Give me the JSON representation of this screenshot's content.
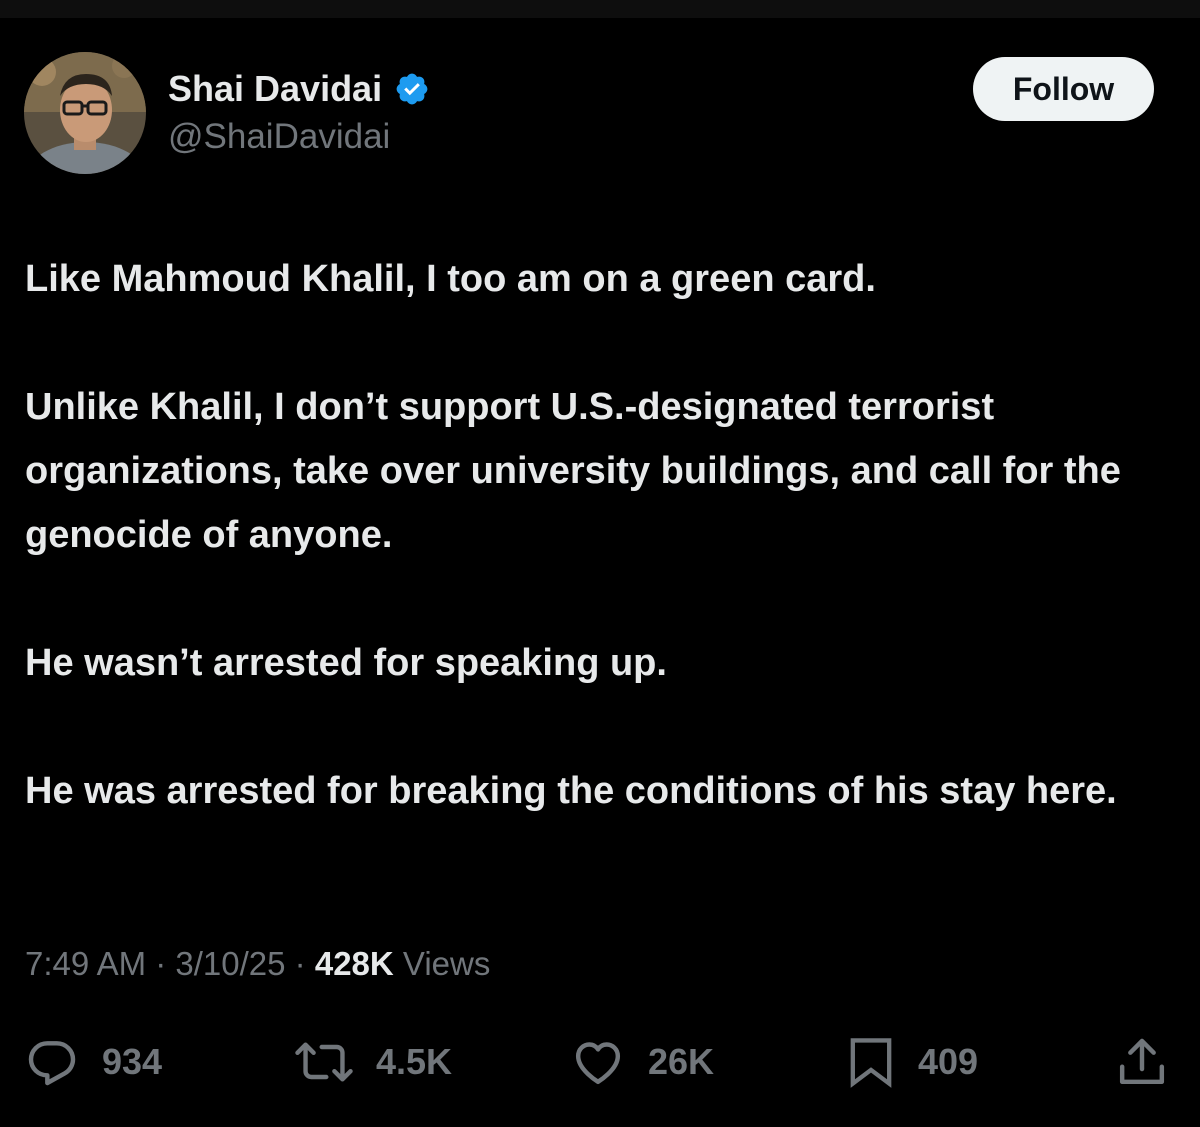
{
  "author": {
    "display_name": "Shai Davidai",
    "handle": "@ShaiDavidai",
    "verified": true,
    "verified_color": "#1d9bf0"
  },
  "follow_button": {
    "label": "Follow"
  },
  "tweet": {
    "paragraphs": [
      "Like Mahmoud Khalil, I too am on a green card.",
      "Unlike Khalil, I don’t support U.S.-designated terrorist organizations, take over university buildings, and call for the genocide of anyone.",
      "He wasn’t arrested for speaking up.",
      "He was arrested for breaking the conditions of his stay here."
    ]
  },
  "meta": {
    "time": "7:49 AM",
    "separator": " · ",
    "date": "3/10/25",
    "views_count": "428K",
    "views_label": "Views"
  },
  "actions": {
    "replies": {
      "icon": "reply-icon",
      "count": "934"
    },
    "reposts": {
      "icon": "repost-icon",
      "count": "4.5K"
    },
    "likes": {
      "icon": "heart-icon",
      "count": "26K"
    },
    "bookmarks": {
      "icon": "bookmark-icon",
      "count": "409"
    },
    "share": {
      "icon": "share-icon"
    }
  },
  "colors": {
    "background": "#000000",
    "primary_text": "#e7e9ea",
    "secondary_text": "#71767b",
    "follow_bg": "#eff3f4"
  }
}
